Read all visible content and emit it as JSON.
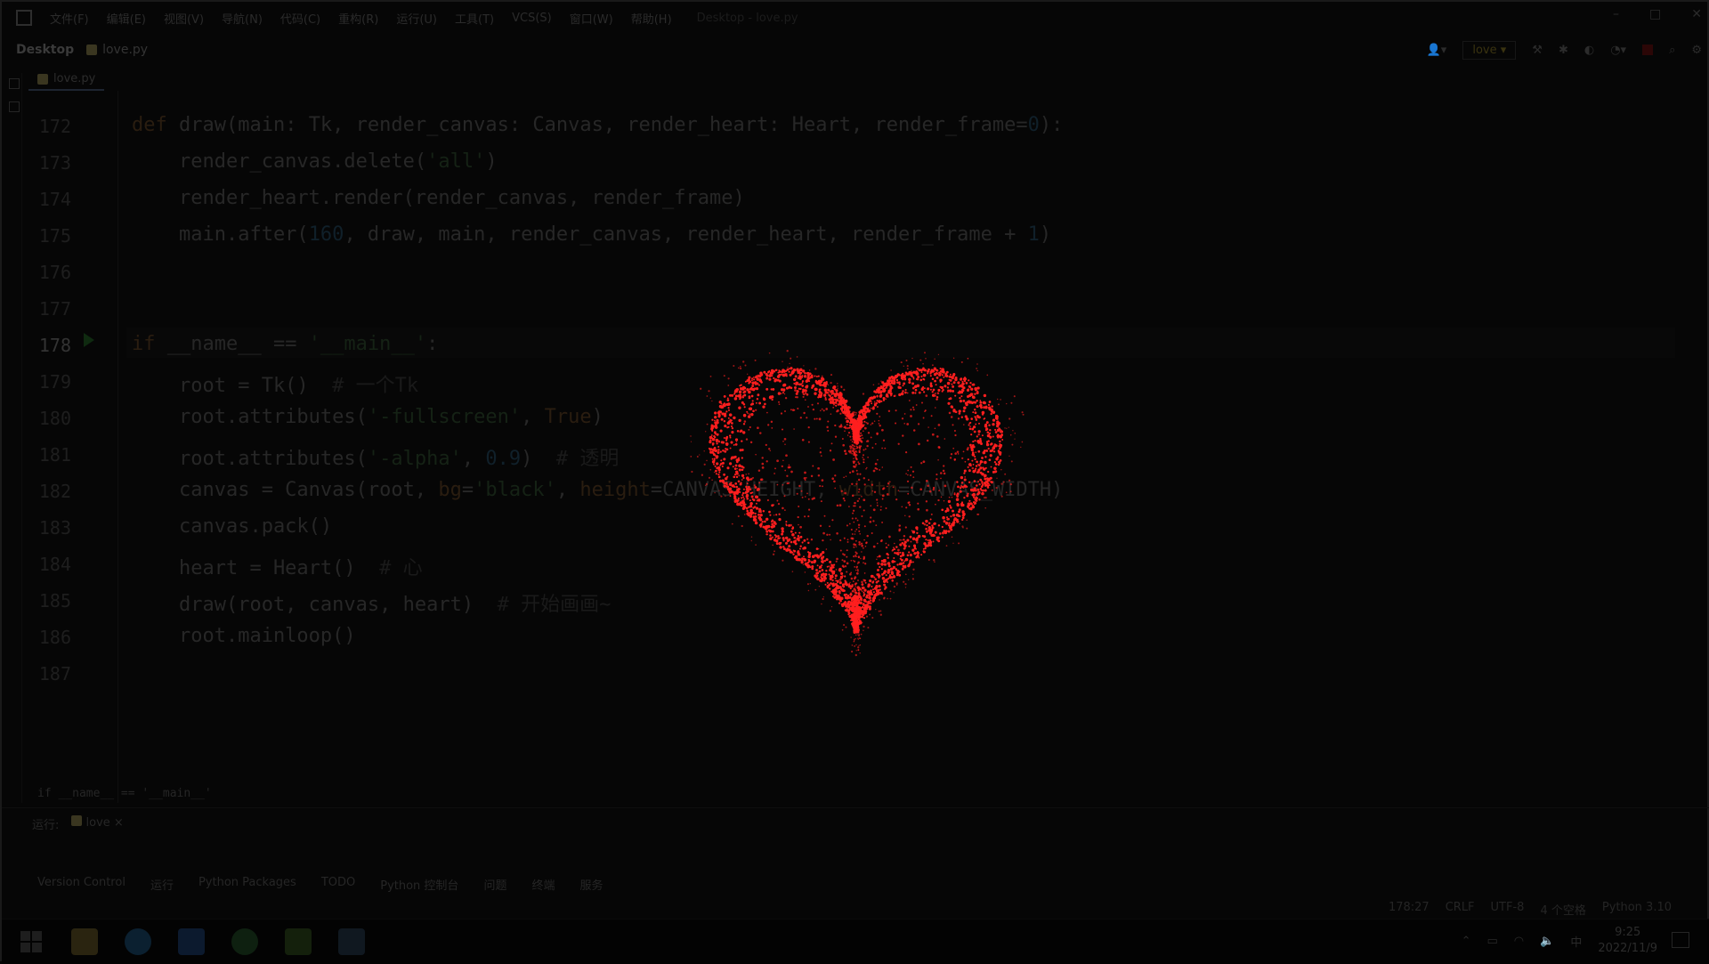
{
  "menu": {
    "items": [
      "文件(F)",
      "编辑(E)",
      "视图(V)",
      "导航(N)",
      "代码(C)",
      "重构(R)",
      "运行(U)",
      "工具(T)",
      "VCS(S)",
      "窗口(W)",
      "帮助(H)"
    ],
    "window_title": "Desktop - love.py"
  },
  "nav": {
    "project": "Desktop",
    "file": "love.py",
    "run_config": "love"
  },
  "tab": {
    "label": "love.py"
  },
  "editor": {
    "line_numbers": [
      "172",
      "173",
      "174",
      "175",
      "176",
      "177",
      "178",
      "179",
      "180",
      "181",
      "182",
      "183",
      "184",
      "185",
      "186",
      "187"
    ],
    "active_line": "178"
  },
  "bottom": {
    "breadcrumb": "if __name__ == '__main__'",
    "run_label": "运行:",
    "run_tab": "love",
    "tools": [
      "Version Control",
      "运行",
      "Python Packages",
      "TODO",
      "Python 控制台",
      "问题",
      "终端",
      "服务"
    ],
    "status": [
      "178:27",
      "CRLF",
      "UTF-8",
      "4 个空格",
      "Python 3.10"
    ]
  },
  "taskbar": {
    "time": "9:25",
    "date": "2022/11/9",
    "ime": "中"
  },
  "colors": {
    "heart": "#ff1f1f",
    "background": "#050505"
  }
}
